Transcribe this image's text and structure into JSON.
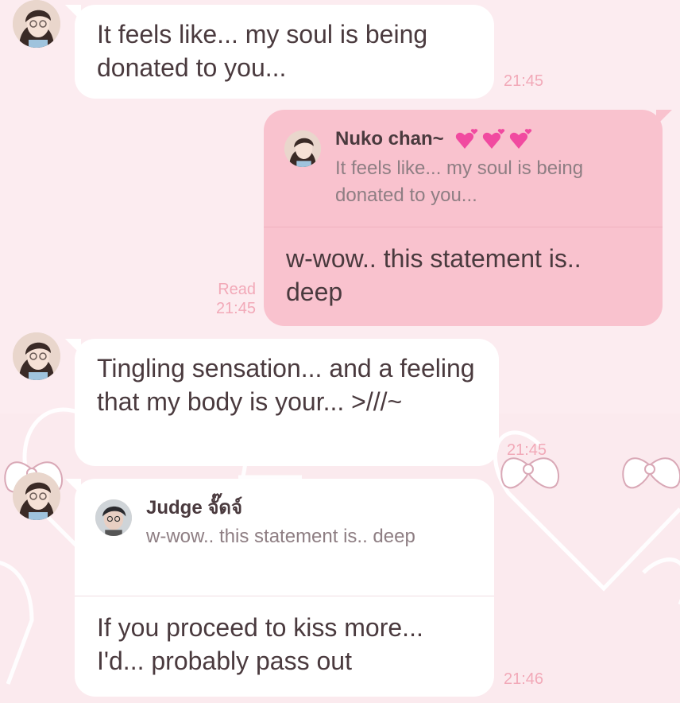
{
  "messages": [
    {
      "type": "incoming",
      "text": "It feels like... my soul is being donated to you...",
      "time": "21:45"
    },
    {
      "type": "outgoing",
      "reply_name": "Nuko chan~",
      "reply_quote": "It feels like... my soul is being donated to you...",
      "text": "w-wow.. this statement is.. deep",
      "status": "Read",
      "time": "21:45"
    },
    {
      "type": "incoming",
      "text": "Tingling sensation... and a feeling that my body is your... >///~",
      "time": "21:45"
    },
    {
      "type": "incoming",
      "reply_name": "Judge จั๊ดจ์",
      "reply_quote": "w-wow.. this statement is.. deep",
      "text": "If you proceed to kiss more... I'd... probably pass out",
      "time": "21:46"
    }
  ],
  "icons": {
    "hearts": "pink-hearts-emoji",
    "avatar_sender": "avatar-photo",
    "avatar_judge": "avatar-photo"
  },
  "colors": {
    "outgoing_bubble": "#f9c2ce",
    "incoming_bubble": "#ffffff",
    "timestamp": "#f2a9b8",
    "background": "#fbeaee"
  }
}
